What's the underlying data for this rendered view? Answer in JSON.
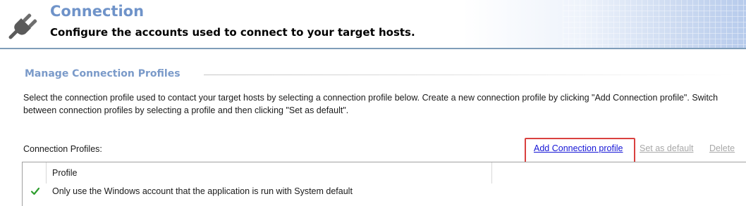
{
  "header": {
    "title": "Connection",
    "subtitle": "Configure the accounts used to connect to your target hosts.",
    "icon": "plug-icon"
  },
  "section": {
    "title": "Manage Connection Profiles",
    "description": "Select the connection profile used to contact your target hosts by selecting a connection profile below. Create a new connection profile by clicking \"Add Connection profile\". Switch between connection profiles by selecting a profile and then clicking \"Set as default\"."
  },
  "profiles": {
    "label": "Connection Profiles:",
    "actions": {
      "add": "Add Connection profile",
      "set_default": "Set as default",
      "delete": "Delete"
    },
    "columns": [
      "Profile"
    ],
    "rows": [
      {
        "text": "Only use the Windows account that the application is run with System default",
        "icon": "checkmark-icon"
      }
    ]
  },
  "colors": {
    "title_blue": "#6f93c9",
    "section_blue": "#7a9ac9",
    "link_blue": "#1515d6",
    "disabled_gray": "#a8a8a8",
    "highlight_red": "#d9413f",
    "check_green": "#2e9e2e"
  }
}
